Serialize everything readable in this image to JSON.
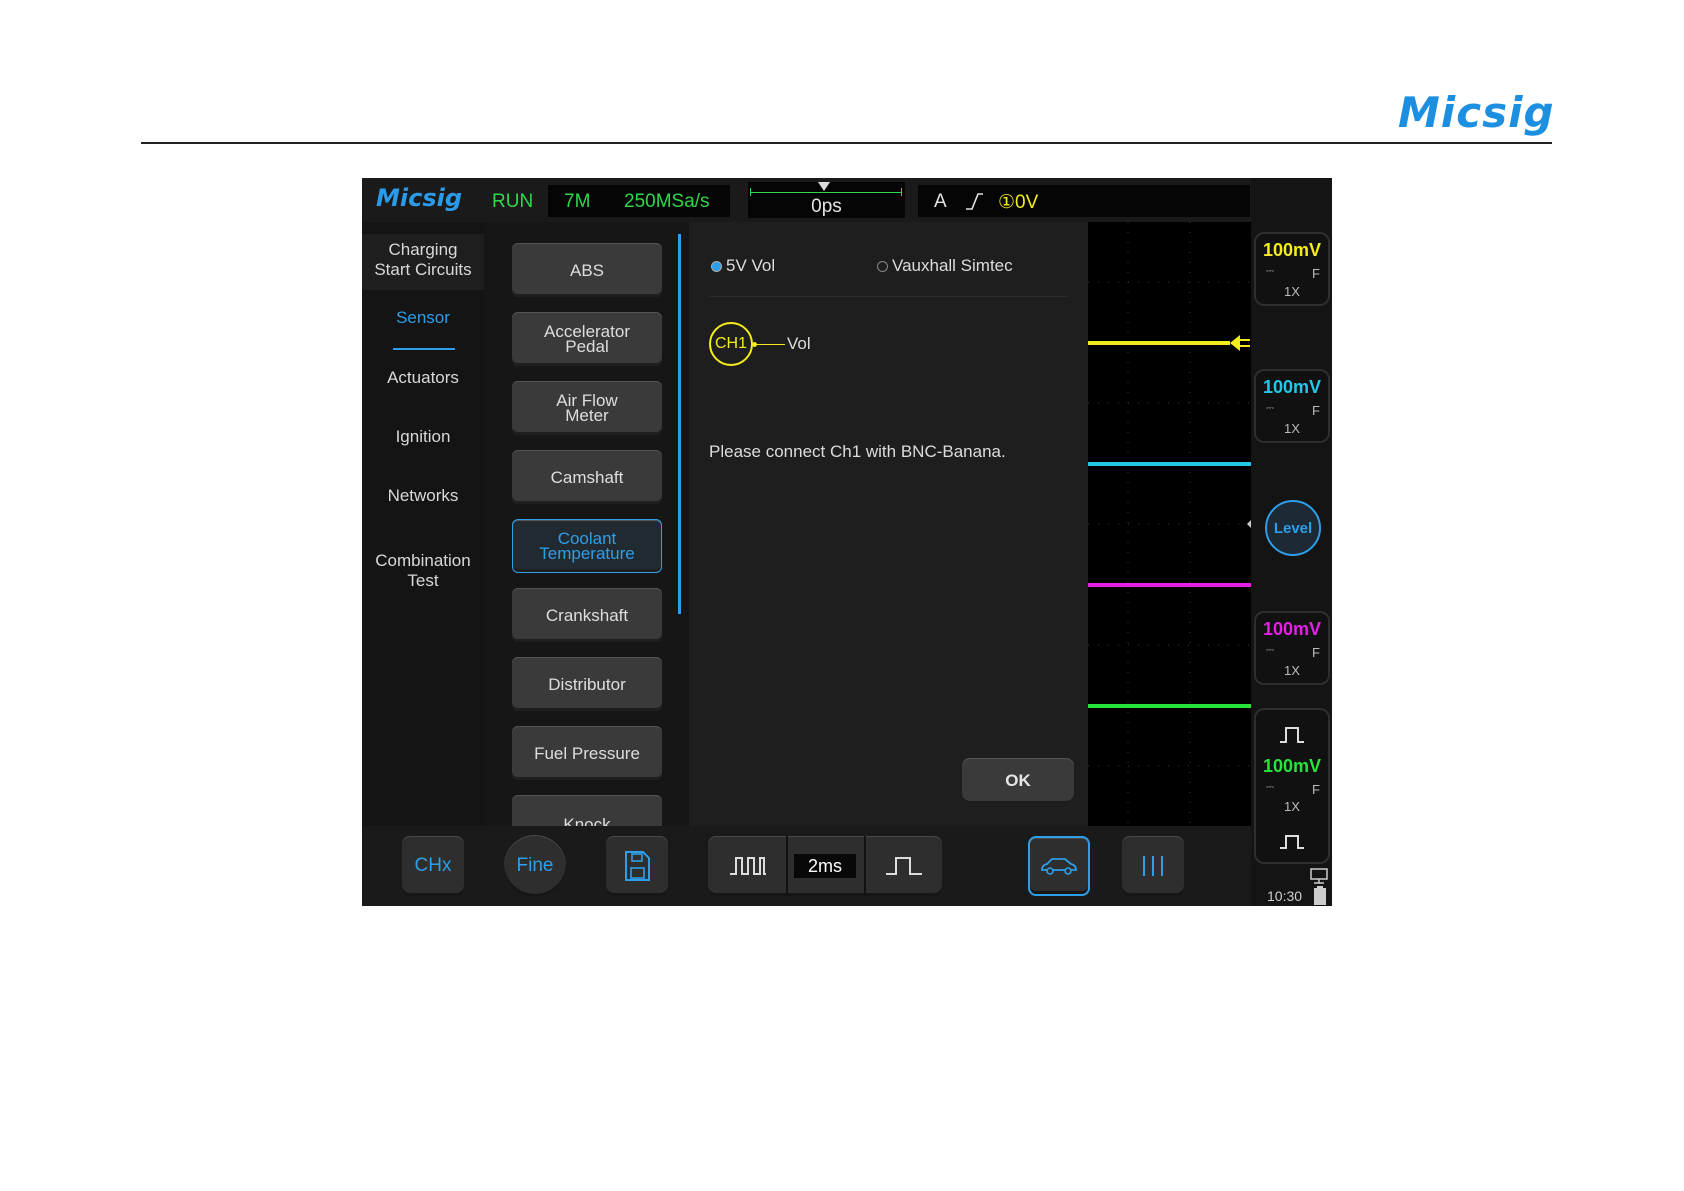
{
  "page": {
    "brand": "Micsig"
  },
  "status": {
    "brand": "Micsig",
    "run_state": "RUN",
    "memory_depth": "7M",
    "sample_rate": "250MSa/s",
    "time_offset": "0ps",
    "trigger_source": "A",
    "trigger_level": "①0V"
  },
  "categories": [
    {
      "label": "Charging\nStart Circuits"
    },
    {
      "label": "Sensor"
    },
    {
      "label": "Actuators"
    },
    {
      "label": "Ignition"
    },
    {
      "label": "Networks"
    },
    {
      "label": "Combination\nTest"
    }
  ],
  "sensors": [
    {
      "label": "ABS"
    },
    {
      "label": "Accelerator\nPedal"
    },
    {
      "label": "Air Flow\nMeter"
    },
    {
      "label": "Camshaft"
    },
    {
      "label": "Coolant\nTemperature"
    },
    {
      "label": "Crankshaft"
    },
    {
      "label": "Distributor"
    },
    {
      "label": "Fuel Pressure"
    },
    {
      "label": "Knock"
    }
  ],
  "detail": {
    "option1": "5V Vol",
    "option2": "Vauxhall Simtec",
    "channel": "CH1",
    "channel_signal": "Vol",
    "message": "Please connect Ch1 with BNC-Banana.",
    "ok_label": "OK"
  },
  "channels": [
    {
      "scale": "100mV",
      "coupling": "F",
      "probe": "1X",
      "color": "#f3ec1b"
    },
    {
      "scale": "100mV",
      "coupling": "F",
      "probe": "1X",
      "color": "#23c8e8"
    },
    {
      "scale": "100mV",
      "coupling": "F",
      "probe": "1X",
      "color": "#e61ee6"
    },
    {
      "scale": "100mV",
      "coupling": "F",
      "probe": "1X",
      "color": "#27e43b"
    }
  ],
  "level_label": "Level",
  "clock": "10:30",
  "toolbar": {
    "chx": "CHx",
    "fine": "Fine",
    "timebase": "2ms"
  },
  "colors": {
    "accent": "#2d9ee8",
    "run": "#2fd84a"
  }
}
